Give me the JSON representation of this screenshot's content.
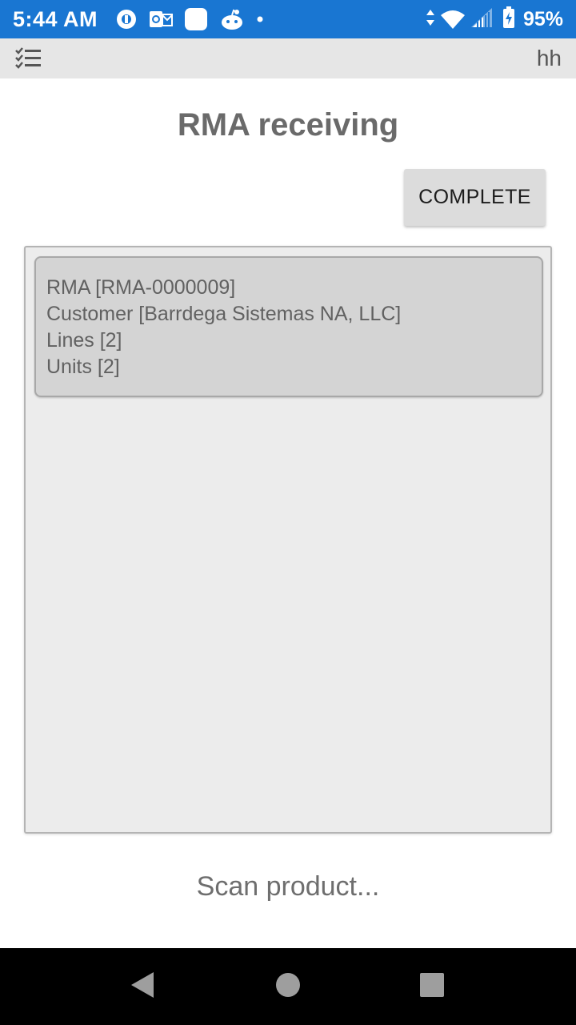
{
  "status_bar": {
    "time": "5:44 AM",
    "battery_percent": "95%",
    "network_badge": "4",
    "color": "#1976d2",
    "notification_icons": [
      "app-circle-icon",
      "outlook-icon",
      "blank-app-icon",
      "reddit-icon",
      "dot-icon"
    ]
  },
  "toolbar": {
    "menu_icon": "checklist-icon",
    "user": "hh"
  },
  "page": {
    "title": "RMA receiving",
    "complete_label": "COMPLETE"
  },
  "rma_card": {
    "lines": [
      "RMA [RMA-0000009]",
      "Customer [Barrdega Sistemas NA, LLC]",
      "Lines [2]",
      "Units [2]"
    ]
  },
  "scan": {
    "placeholder": "Scan product..."
  },
  "nav": {
    "icons": [
      "back-icon",
      "home-icon",
      "recents-icon"
    ]
  }
}
